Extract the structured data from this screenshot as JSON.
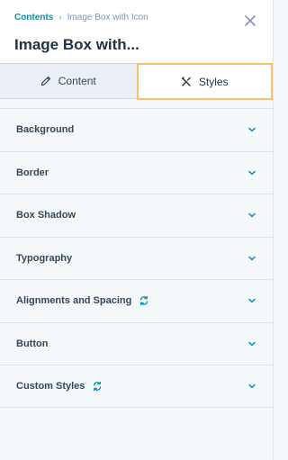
{
  "header": {
    "breadcrumb_parent": "Contents",
    "breadcrumb_separator": "›",
    "breadcrumb_current": "Image Box with Icon",
    "title": "Image Box with..."
  },
  "tabs": [
    {
      "label": "Content",
      "icon": "pencil-icon",
      "active": false
    },
    {
      "label": "Styles",
      "icon": "styles-icon",
      "active": true
    }
  ],
  "sections": [
    {
      "label": "Background",
      "sync": false
    },
    {
      "label": "Border",
      "sync": false
    },
    {
      "label": "Box Shadow",
      "sync": false
    },
    {
      "label": "Typography",
      "sync": false
    },
    {
      "label": "Alignments and Spacing",
      "sync": true
    },
    {
      "label": "Button",
      "sync": false
    },
    {
      "label": "Custom Styles",
      "sync": true
    }
  ],
  "colors": {
    "accent": "#0091ae",
    "tab_highlight": "#f5c26b",
    "title": "#213343"
  }
}
